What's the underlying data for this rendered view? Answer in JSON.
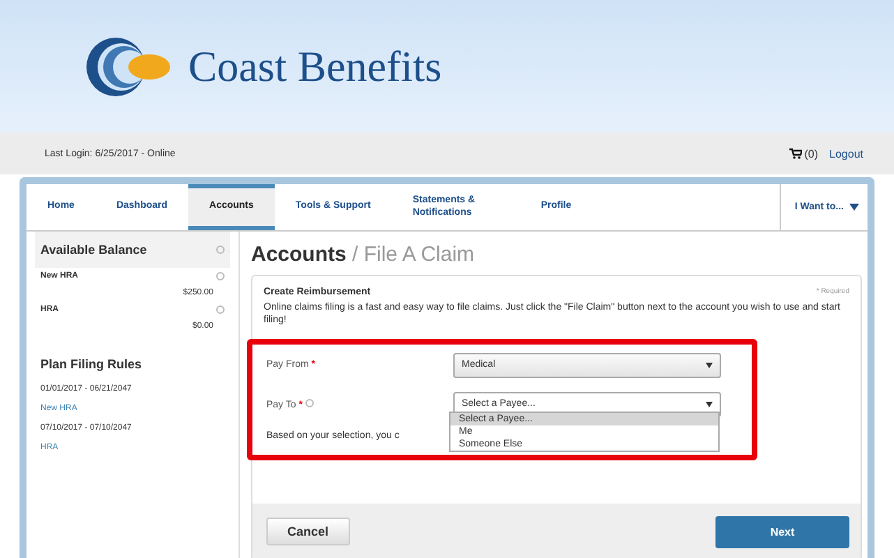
{
  "header": {
    "brand": "Coast Benefits"
  },
  "login_bar": {
    "last_login": "Last Login: 6/25/2017 - Online",
    "cart_count": "(0)",
    "logout": "Logout"
  },
  "nav": {
    "tabs": [
      {
        "label": "Home",
        "selected": false
      },
      {
        "label": "Dashboard",
        "selected": false
      },
      {
        "label": "Accounts",
        "selected": true
      },
      {
        "label": "Tools & Support",
        "selected": false
      },
      {
        "label": "Statements & Notifications",
        "selected": false
      },
      {
        "label": "Profile",
        "selected": false
      }
    ],
    "menu": "I Want to..."
  },
  "sidebar": {
    "balance_title": "Available Balance",
    "accounts": [
      {
        "name": "New HRA",
        "amount": "$250.00"
      },
      {
        "name": "HRA",
        "amount": "$0.00"
      }
    ],
    "rules_title": "Plan Filing Rules",
    "rules": [
      {
        "dates": "01/01/2017 - 06/21/2047",
        "plan": "New HRA"
      },
      {
        "dates": "07/10/2017 - 07/10/2047",
        "plan": "HRA"
      }
    ]
  },
  "page": {
    "section": "Accounts",
    "separator": "/",
    "title": "File A Claim"
  },
  "form": {
    "heading": "Create Reimbursement",
    "required_note": "* Required",
    "intro": "Online claims filing is a fast and easy way to file claims. Just click the \"File Claim\" button next to the account you wish to use and start filing!",
    "pay_from": {
      "label": "Pay From",
      "required_mark": "*",
      "value": "Medical"
    },
    "pay_to": {
      "label": "Pay To",
      "required_mark": "*",
      "value": "Select a Payee...",
      "expanded": true,
      "options": [
        {
          "label": "Select a Payee...",
          "selected": true
        },
        {
          "label": "Me",
          "selected": false
        },
        {
          "label": "Someone Else",
          "selected": false
        }
      ]
    },
    "hint": "Based on your selection, you c"
  },
  "buttons": {
    "cancel": "Cancel",
    "next": "Next"
  }
}
